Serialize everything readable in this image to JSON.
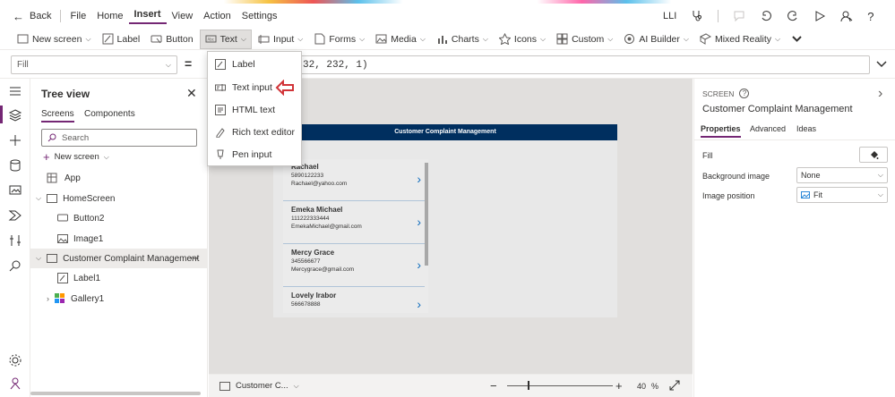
{
  "menubar": {
    "back_label": "Back",
    "items": [
      "File",
      "Home",
      "Insert",
      "View",
      "Action",
      "Settings"
    ],
    "active": "Insert",
    "user_initials": "LLI"
  },
  "ribbon": {
    "items": [
      {
        "label": "New screen",
        "icon": "new-screen-icon"
      },
      {
        "label": "Label",
        "icon": "label-icon"
      },
      {
        "label": "Button",
        "icon": "button-icon"
      },
      {
        "label": "Text",
        "icon": "text-icon"
      },
      {
        "label": "Input",
        "icon": "input-icon"
      },
      {
        "label": "Forms",
        "icon": "forms-icon"
      },
      {
        "label": "Media",
        "icon": "media-icon"
      },
      {
        "label": "Charts",
        "icon": "charts-icon"
      },
      {
        "label": "Icons",
        "icon": "icons-icon"
      },
      {
        "label": "Custom",
        "icon": "custom-icon"
      },
      {
        "label": "AI Builder",
        "icon": "ai-builder-icon"
      },
      {
        "label": "Mixed Reality",
        "icon": "mixed-reality-icon"
      }
    ]
  },
  "formula": {
    "property": "Fill",
    "equals": "=",
    "visible_tail_a": "32, 232, 1)"
  },
  "text_menu": {
    "items": [
      "Label",
      "Text input",
      "HTML text",
      "Rich text editor",
      "Pen input"
    ]
  },
  "tree": {
    "title": "Tree view",
    "tabs": [
      "Screens",
      "Components"
    ],
    "search_placeholder": "Search",
    "new_screen": "New screen",
    "rows": [
      "App",
      "HomeScreen",
      "Button2",
      "Image1",
      "Customer Complaint Management",
      "Label1",
      "Gallery1"
    ]
  },
  "canvas": {
    "header": "Customer Complaint Management",
    "gallery": [
      {
        "name": "Rachael",
        "phone": "5890122233",
        "email": "Rachael@yahoo.com"
      },
      {
        "name": "Emeka Michael",
        "phone": "111222333444",
        "email": "EmekaMichael@gmail.com"
      },
      {
        "name": "Mercy Grace",
        "phone": "345566677",
        "email": "Mercygrace@gmail.com"
      },
      {
        "name": "Lovely Irabor",
        "phone": "566678888",
        "email": ""
      }
    ],
    "bottom_screen": "Customer C...",
    "zoom": "40",
    "zoom_unit": "%"
  },
  "panel": {
    "type_label": "SCREEN",
    "screen_name": "Customer Complaint Management",
    "tabs": [
      "Properties",
      "Advanced",
      "Ideas"
    ],
    "fill_label": "Fill",
    "bg_image_label": "Background image",
    "bg_image_value": "None",
    "image_position_label": "Image position",
    "image_position_value": "Fit"
  },
  "colors": {
    "accent": "#742774",
    "header_bg": "#002f5f",
    "arrow_red": "#d13438"
  }
}
